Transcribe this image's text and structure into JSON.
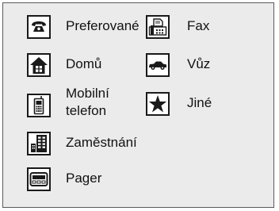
{
  "phone_types": {
    "items": [
      {
        "key": "preferred",
        "label": "Preferované",
        "icon": "telephone-icon"
      },
      {
        "key": "fax",
        "label": "Fax",
        "icon": "fax-machine-icon"
      },
      {
        "key": "home",
        "label": "Domů",
        "icon": "house-icon"
      },
      {
        "key": "car",
        "label": "Vůz",
        "icon": "car-icon"
      },
      {
        "key": "mobile",
        "label_line1": "Mobilní",
        "label_line2": "telefon",
        "icon": "mobile-phone-icon"
      },
      {
        "key": "other",
        "label": "Jiné",
        "icon": "star-icon"
      },
      {
        "key": "work",
        "label": "Zaměstnání",
        "icon": "office-building-icon"
      },
      {
        "key": "pager",
        "label": "Pager",
        "icon": "pager-icon"
      }
    ]
  },
  "colors": {
    "panel_background": "#ebebeb",
    "panel_border": "#5a5a5a",
    "icon_foreground": "#1a1a1a",
    "icon_background": "#ffffff"
  }
}
